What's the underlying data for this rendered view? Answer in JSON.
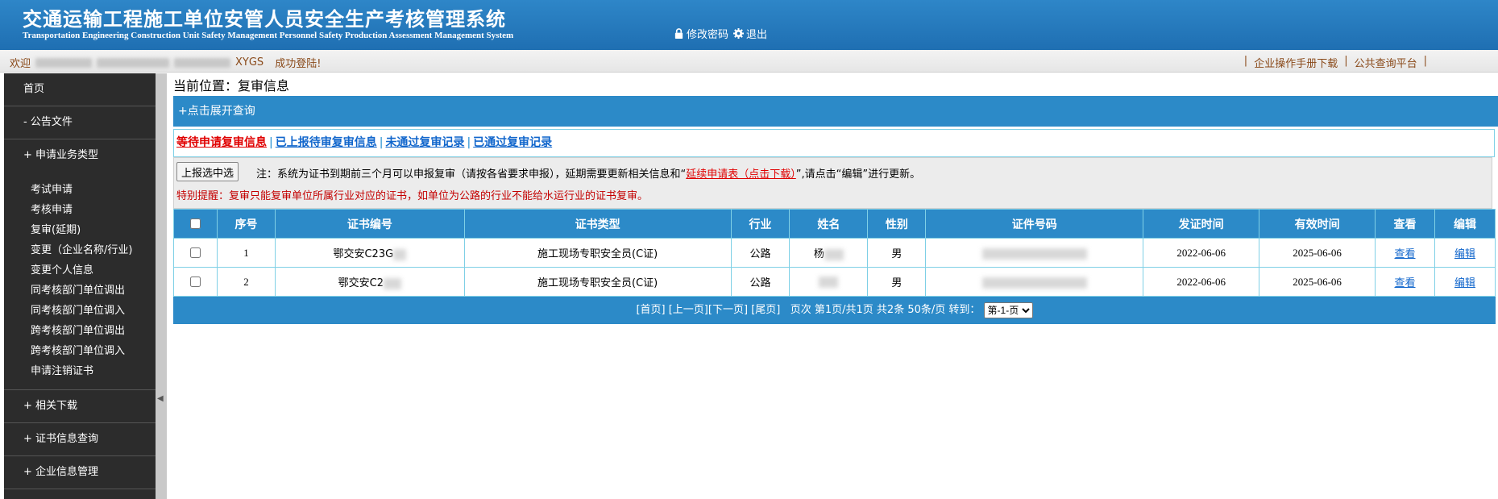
{
  "header": {
    "title": "交通运输工程施工单位安管人员安全生产考核管理系统",
    "subtitle": "Transportation Engineering Construction Unit Safety Management Personnel Safety Production Assessment Management System",
    "change_password": "修改密码",
    "logout": "退出",
    "icons": [
      "lock-icon",
      "gear-icon"
    ]
  },
  "welcome": {
    "greeting": "欢迎",
    "user_suffix": "XYGS",
    "login_ok": "成功登陆!",
    "links": [
      "企业操作手册下载",
      "公共查询平台"
    ]
  },
  "sidebar": {
    "home": "首页",
    "notices": "- 公告文件",
    "business_types": "+ 申请业务类型",
    "business_items": [
      "考试申请",
      "考核申请",
      "复审(延期)",
      "变更（企业名称/行业)",
      "变更个人信息",
      "同考核部门单位调出",
      "同考核部门单位调入",
      "跨考核部门单位调出",
      "跨考核部门单位调入",
      "申请注销证书"
    ],
    "downloads": "+ 相关下载",
    "cert_query": "+ 证书信息查询",
    "company_info": "+ 企业信息管理"
  },
  "main": {
    "breadcrumb": "当前位置：复审信息",
    "expand_query": "+点击展开查询",
    "tabs": [
      {
        "label": "等待申请复审信息",
        "color": "#e00000"
      },
      {
        "label": "已上报待审复审信息",
        "color": "#1166cc"
      },
      {
        "label": "未通过复审记录",
        "color": "#1166cc"
      },
      {
        "label": "已通过复审记录",
        "color": "#1166cc"
      }
    ],
    "upload_button": "上报选中选",
    "note_prefix": "注：系统为证书到期前三个月可以申报复审（请按各省要求申报），延期需要更新相关信息和“",
    "note_link": "延续申请表（点击下载）",
    "note_suffix": "”,请点击“编辑”进行更新。",
    "special_notice": "特别提醒：复审只能复审单位所属行业对应的证书，如单位为公路的行业不能给水运行业的证书复审。"
  },
  "table": {
    "headers": [
      "序号",
      "证书编号",
      "证书类型",
      "行业",
      "姓名",
      "性别",
      "证件号码",
      "发证时间",
      "有效时间",
      "查看",
      "编辑"
    ],
    "rows": [
      {
        "seq": "1",
        "cert_no": "鄂交安C23G",
        "cert_type": "施工现场专职安全员(C证)",
        "industry": "公路",
        "name": "杨",
        "gender": "男",
        "issue_date": "2022-06-06",
        "valid_date": "2025-06-06",
        "view": "查看",
        "edit": "编辑"
      },
      {
        "seq": "2",
        "cert_no": "鄂交安C2",
        "cert_type": "施工现场专职安全员(C证)",
        "industry": "公路",
        "name": "",
        "gender": "男",
        "issue_date": "2022-06-06",
        "valid_date": "2025-06-06",
        "view": "查看",
        "edit": "编辑"
      }
    ]
  },
  "pager": {
    "first": "[首页]",
    "prev": "[上一页]",
    "next": "[下一页]",
    "last": "[尾页]",
    "info": "页次 第1页/共1页 共2条 50条/页 转到：",
    "select_value": "第-1-页"
  }
}
